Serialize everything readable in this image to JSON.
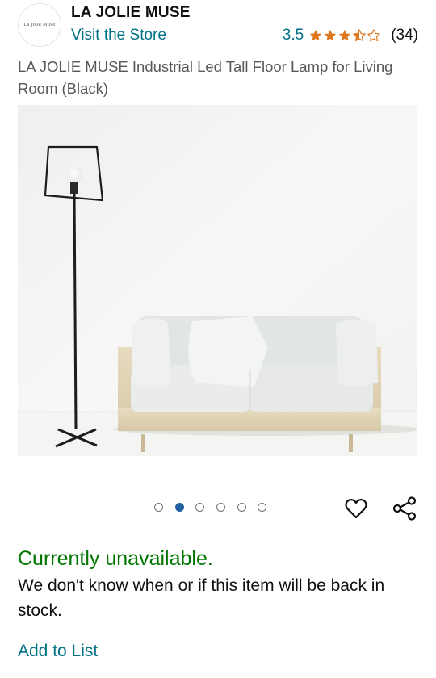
{
  "store": {
    "logo_text": "La Jolie Muse",
    "name": "LA JOLIE MUSE",
    "visit_label": "Visit the Store"
  },
  "rating": {
    "score": "3.5",
    "stars_value": 3.5,
    "count": "(34)"
  },
  "product": {
    "title": "LA JOLIE MUSE Industrial Led Tall Floor Lamp for Living Room (Black)"
  },
  "gallery": {
    "image_count": 6,
    "active_index": 1,
    "accent": "#2162a1"
  },
  "actions": {
    "wishlist_icon": "heart-icon",
    "share_icon": "share-icon"
  },
  "availability": {
    "status": "Currently unavailable.",
    "message": "We don't know when or if this item will be back in stock.",
    "status_color": "#007600"
  },
  "add_to_list_label": "Add to List"
}
